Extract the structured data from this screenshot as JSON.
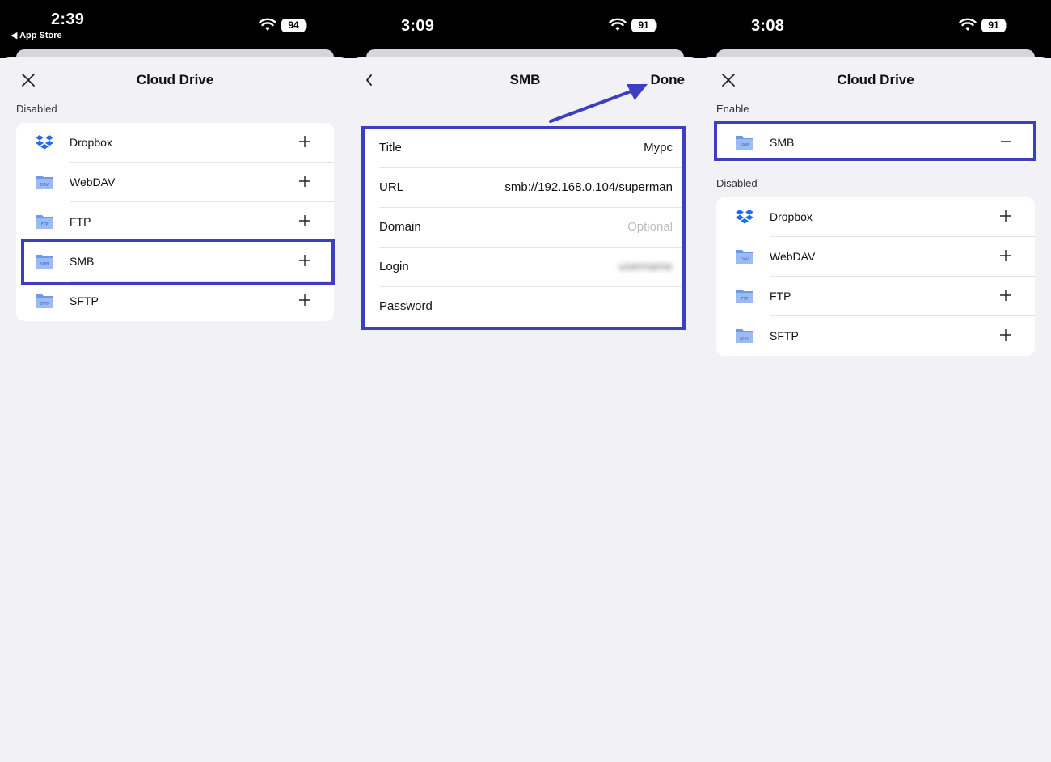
{
  "accent_color": "#3c3fbf",
  "screen1": {
    "status": {
      "time": "2:39",
      "back_app": "◀ App Store",
      "battery": "94"
    },
    "title": "Cloud Drive",
    "section_disabled": "Disabled",
    "items": [
      {
        "label": "Dropbox",
        "icon": "dropbox-icon"
      },
      {
        "label": "WebDAV",
        "icon": "webdav-folder-icon",
        "badge": "DAV"
      },
      {
        "label": "FTP",
        "icon": "ftp-folder-icon",
        "badge": "FTP"
      },
      {
        "label": "SMB",
        "icon": "smb-folder-icon",
        "badge": "SMB"
      },
      {
        "label": "SFTP",
        "icon": "sftp-folder-icon",
        "badge": "SFTP"
      }
    ]
  },
  "screen2": {
    "status": {
      "time": "3:09",
      "battery": "91"
    },
    "title": "SMB",
    "done_label": "Done",
    "fields": [
      {
        "label": "Title",
        "value": "Mypc",
        "placeholder": ""
      },
      {
        "label": "URL",
        "value": "smb://192.168.0.104/superman",
        "placeholder": ""
      },
      {
        "label": "Domain",
        "value": "",
        "placeholder": "Optional"
      },
      {
        "label": "Login",
        "value": "username",
        "placeholder": ""
      },
      {
        "label": "Password",
        "value": "",
        "placeholder": ""
      }
    ]
  },
  "screen3": {
    "status": {
      "time": "3:08",
      "battery": "91"
    },
    "title": "Cloud Drive",
    "section_enable": "Enable",
    "enabled_items": [
      {
        "label": "SMB",
        "icon": "smb-folder-icon",
        "badge": "SMB"
      }
    ],
    "section_disabled": "Disabled",
    "items": [
      {
        "label": "Dropbox",
        "icon": "dropbox-icon"
      },
      {
        "label": "WebDAV",
        "icon": "webdav-folder-icon",
        "badge": "DAV"
      },
      {
        "label": "FTP",
        "icon": "ftp-folder-icon",
        "badge": "FTP"
      },
      {
        "label": "SFTP",
        "icon": "sftp-folder-icon",
        "badge": "SFTP"
      }
    ]
  }
}
